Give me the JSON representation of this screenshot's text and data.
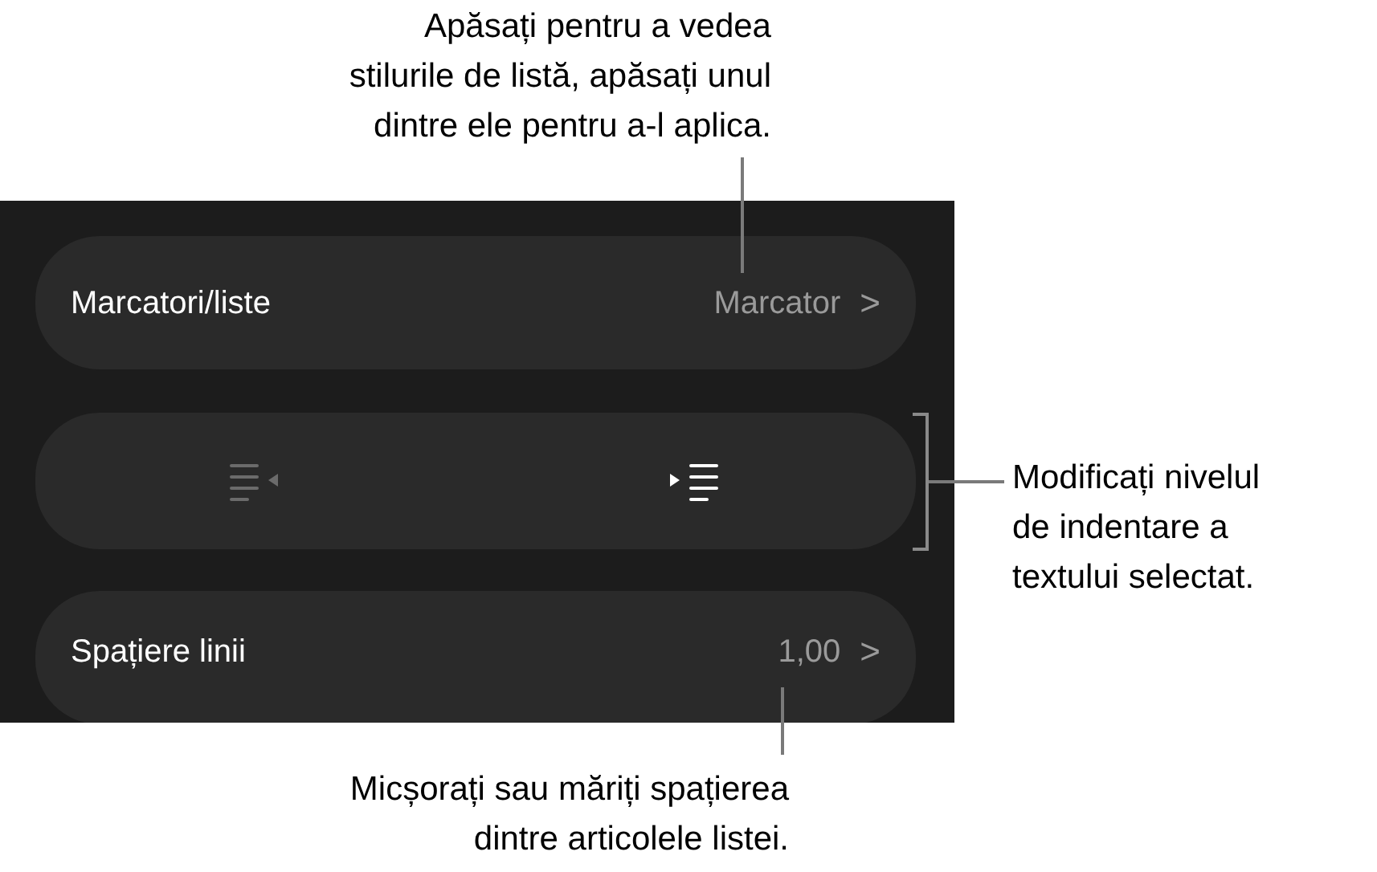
{
  "panel": {
    "rows": [
      {
        "kind": "disclosure",
        "label": "Marcatori/liste",
        "value": "Marcator",
        "chevron": ">"
      },
      {
        "kind": "indent",
        "buttons": [
          {
            "kind": "outdent",
            "disabled": true
          },
          {
            "kind": "indent",
            "disabled": false
          }
        ]
      },
      {
        "kind": "disclosure",
        "label": "Spațiere linii",
        "value": "1,00",
        "chevron": ">"
      }
    ]
  },
  "callouts": [
    {
      "kind": "top",
      "lines": [
        "Apăsați pentru a vedea",
        "stilurile de listă, apăsați unul",
        "dintre ele pentru a-l aplica."
      ]
    },
    {
      "kind": "right",
      "lines": [
        "Modificați nivelul",
        "de indentare a",
        "textului selectat."
      ]
    },
    {
      "kind": "bottom",
      "lines": [
        "Micșorați sau măriți spațierea",
        "dintre articolele listei."
      ]
    }
  ]
}
